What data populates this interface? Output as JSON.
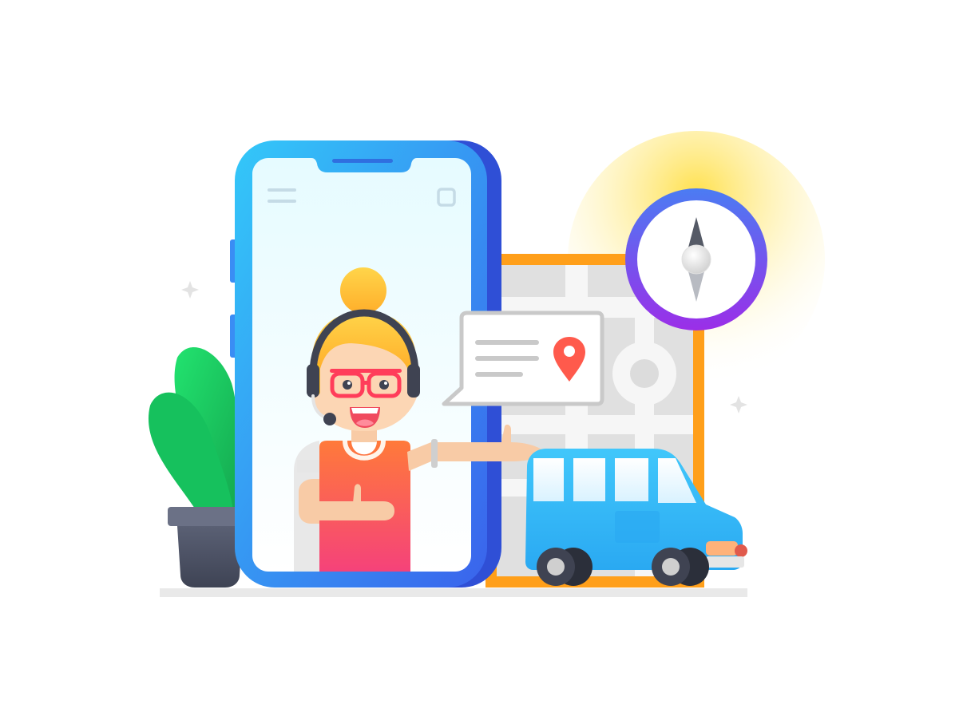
{
  "illustration": {
    "elements": {
      "sparkles": "sparkle-icon",
      "sun": "sun-glow",
      "map": "map-icon",
      "compass": "compass-icon",
      "plant": "potted-plant",
      "phone": "smartphone",
      "menu": "menu-icon",
      "square": "square-icon",
      "agent": "support-agent",
      "headset": "headset-icon",
      "bubble": "speech-bubble",
      "pin": "location-pin-icon",
      "van": "van"
    },
    "colors": {
      "phone_blue": "#3d8cf5",
      "phone_dark": "#2f4fd6",
      "screen_top": "#e6fbff",
      "map_border": "#ff9f1a",
      "sun_yellow": "#ffe04a",
      "compass_ring_top": "#4b7cf3",
      "compass_ring_bottom": "#9b2ee8",
      "plant_green": "#1bd36a",
      "pot": "#4b5163",
      "hair": "#ffc21a",
      "shirt_top": "#ff7a3a",
      "shirt_bottom": "#f5427a",
      "glasses": "#ff3d5a",
      "van_blue": "#33bbf8",
      "pin_red": "#ff5a4c",
      "ground": "#e6e6e6"
    }
  }
}
